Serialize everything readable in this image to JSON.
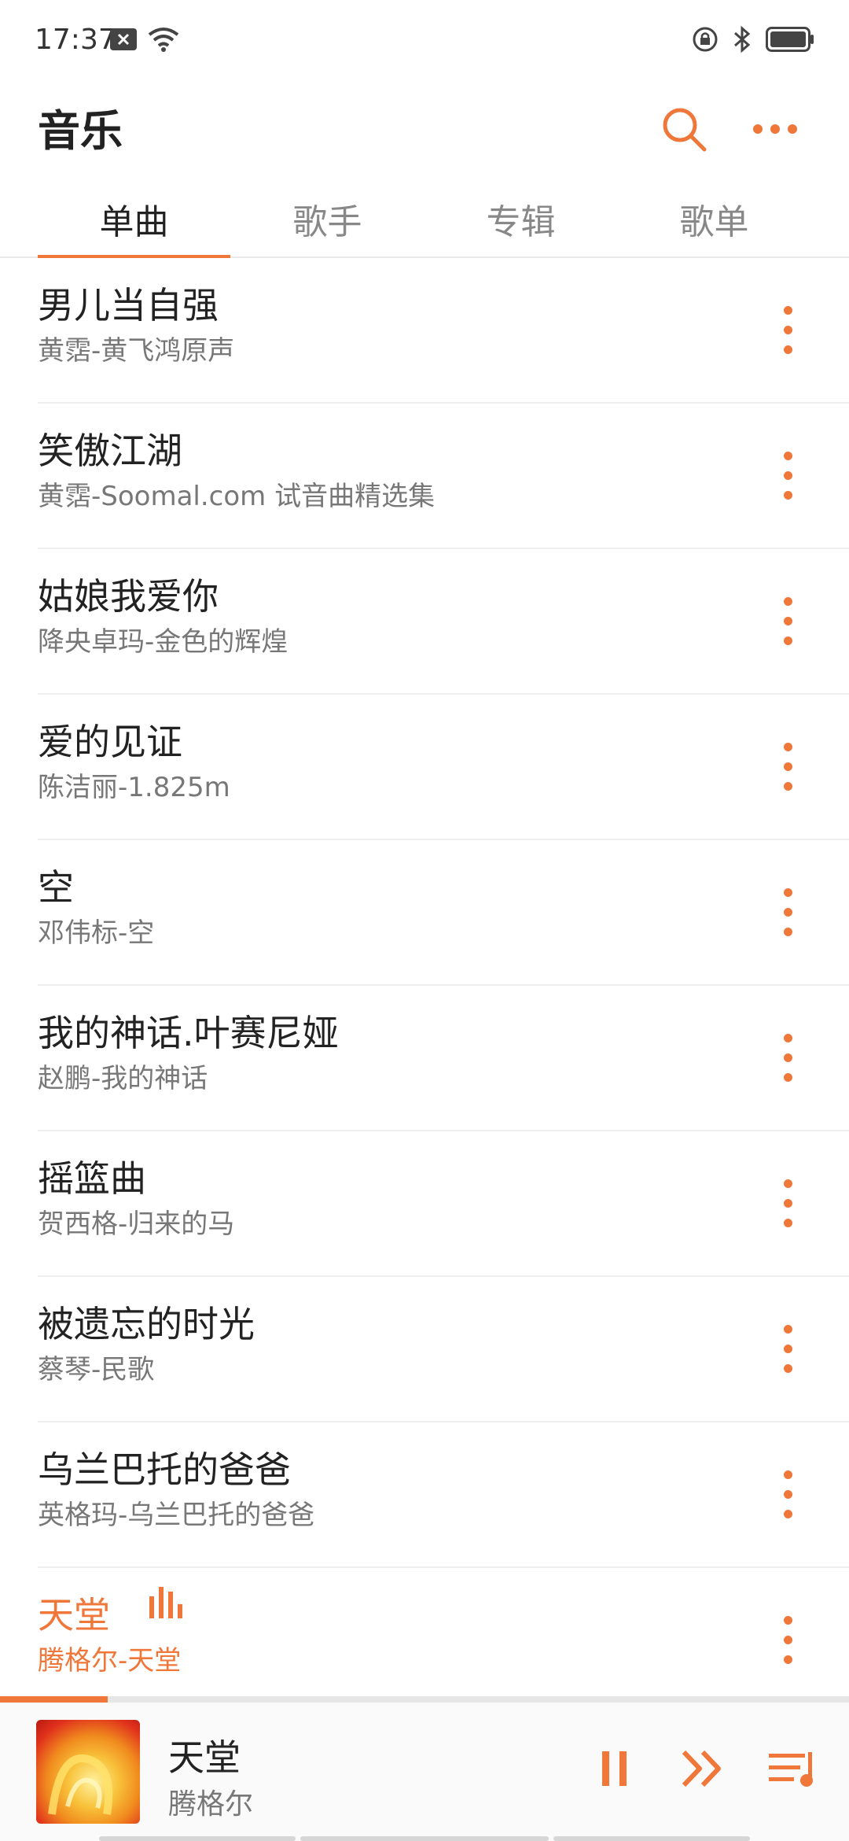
{
  "status_bar": {
    "time": "17:37"
  },
  "header": {
    "title": "音乐"
  },
  "tabs": [
    {
      "label": "单曲",
      "active": true
    },
    {
      "label": "歌手",
      "active": false
    },
    {
      "label": "专辑",
      "active": false
    },
    {
      "label": "歌单",
      "active": false
    }
  ],
  "songs": [
    {
      "title": "男儿当自强",
      "subtitle": "黄霑-黄飞鸿原声"
    },
    {
      "title": "笑傲江湖",
      "subtitle": "黄霑-Soomal.com 试音曲精选集"
    },
    {
      "title": "姑娘我爱你",
      "subtitle": "降央卓玛-金色的辉煌"
    },
    {
      "title": "爱的见证",
      "subtitle": "陈洁丽-1.825m"
    },
    {
      "title": "空",
      "subtitle": "邓伟标-空"
    },
    {
      "title": "我的神话.叶赛尼娅",
      "subtitle": "赵鹏-我的神话"
    },
    {
      "title": "摇篮曲",
      "subtitle": "贺西格-归来的马"
    },
    {
      "title": "被遗忘的时光",
      "subtitle": "蔡琴-民歌"
    },
    {
      "title": "乌兰巴托的爸爸",
      "subtitle": "英格玛-乌兰巴托的爸爸"
    },
    {
      "title": "天堂",
      "subtitle": "腾格尔-天堂",
      "playing": true
    }
  ],
  "player": {
    "title": "天堂",
    "artist": "腾格尔",
    "progress": 0.127
  },
  "colors": {
    "accent": "#f0773a"
  }
}
